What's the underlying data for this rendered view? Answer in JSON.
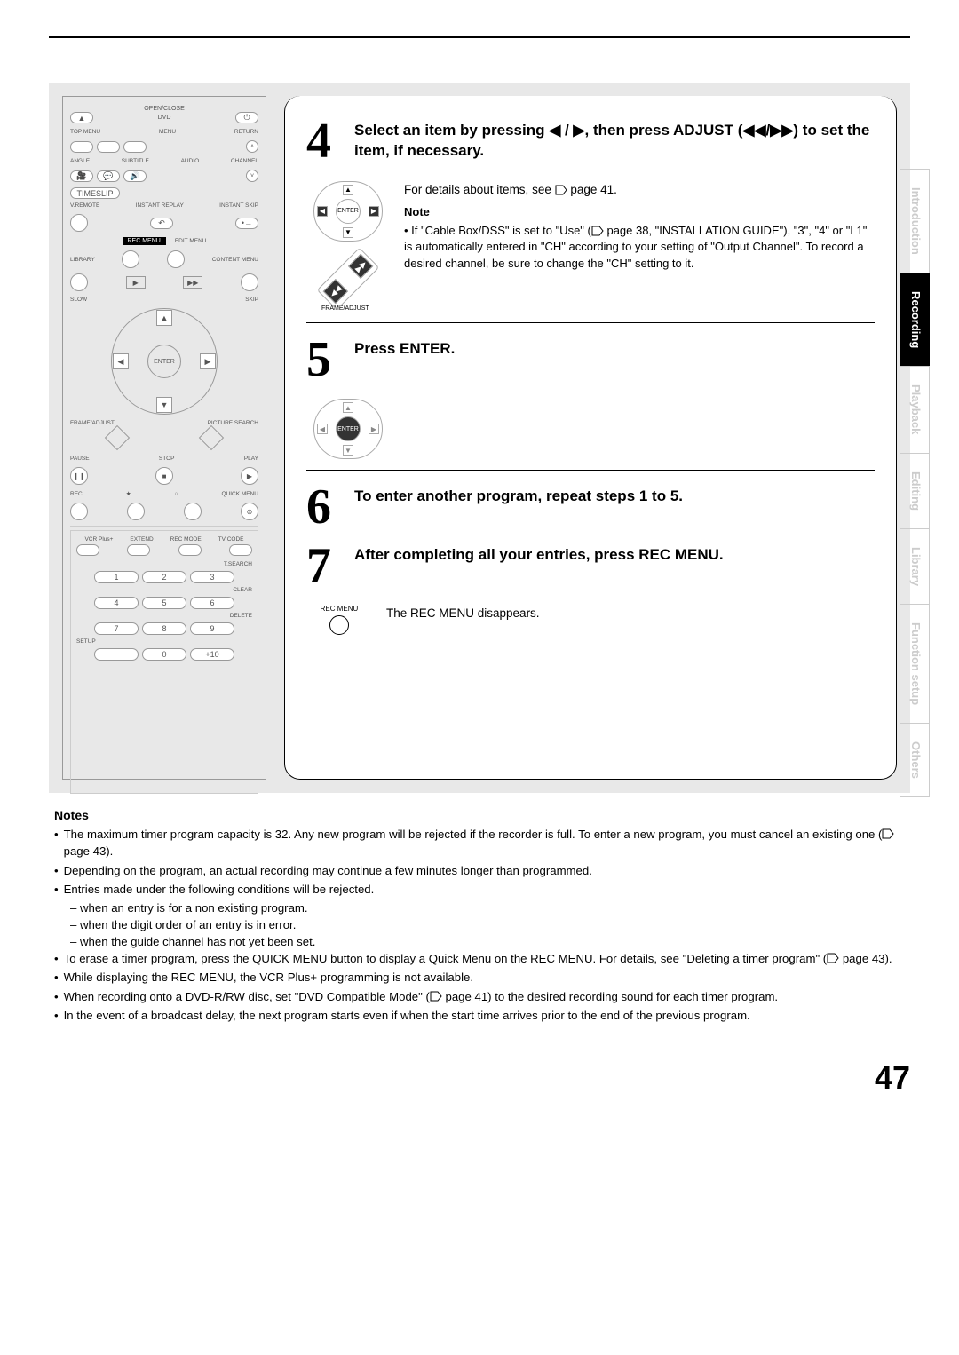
{
  "page_number": "47",
  "side_tabs": [
    "Introduction",
    "Recording",
    "Playback",
    "Editing",
    "Library",
    "Function setup",
    "Others"
  ],
  "active_tab_index": 1,
  "remote": {
    "open_close": "OPEN/CLOSE",
    "dvd": "DVD",
    "top_menu": "TOP MENU",
    "menu": "MENU",
    "return": "RETURN",
    "angle": "ANGLE",
    "subtitle": "SUBTITLE",
    "audio": "AUDIO",
    "channel": "CHANNEL",
    "timeslip": "TIMESLIP",
    "vremote": "V.REMOTE",
    "instant_replay": "INSTANT REPLAY",
    "instant_skip": "INSTANT SKIP",
    "rec_menu": "REC MENU",
    "edit_menu": "EDIT MENU",
    "library": "LIBRARY",
    "content_menu": "CONTENT MENU",
    "enter": "ENTER",
    "skip": "SKIP",
    "slow": "SLOW",
    "frame_adjust": "FRAME/ADJUST",
    "picture_search": "PICTURE SEARCH",
    "pause": "PAUSE",
    "stop": "STOP",
    "play": "PLAY",
    "rec": "REC",
    "quick_menu": "QUICK MENU",
    "vcr_plus": "VCR Plus+",
    "extend": "EXTEND",
    "rec_mode": "REC MODE",
    "tv_code": "TV CODE",
    "t_search": "T.SEARCH",
    "clear": "CLEAR",
    "delete": "DELETE",
    "setup": "SETUP",
    "plus10": "+10"
  },
  "steps": {
    "s4": {
      "num": "4",
      "title": "Select an item by pressing ◀ / ▶, then press ADJUST (◀◀/▶▶) to set the item, if necessary.",
      "body_line1": "For details about items, see ",
      "body_line1_page": "page 41.",
      "note_label": "Note",
      "note_text": "• If \"Cable Box/DSS\" is set to \"Use\" ( page 38, \"INSTALLATION GUIDE\"), \"3\", \"4\" or \"L1\" is automatically entered in \"CH\" according to your setting of \"Output Channel\". To record a desired channel, be sure to change the \"CH\" setting to it.",
      "thumb_enter": "ENTER",
      "thumb_frame": "FRAME/ADJUST"
    },
    "s5": {
      "num": "5",
      "title": "Press ENTER.",
      "thumb_enter": "ENTER"
    },
    "s6": {
      "num": "6",
      "title": "To enter another program, repeat steps 1 to 5."
    },
    "s7": {
      "num": "7",
      "title": "After completing all your entries, press REC MENU.",
      "body": "The REC MENU disappears.",
      "thumb": "REC MENU"
    }
  },
  "notes": {
    "header": "Notes",
    "items": [
      "The maximum timer program capacity is 32. Any new program will be rejected if the recorder is full. To enter a new program, you must cancel an existing one ( page 43).",
      "Depending on the program, an actual recording may continue a few minutes longer than programmed.",
      "Entries made under the following conditions will be rejected.",
      "To erase a timer program, press the QUICK MENU button to display a Quick Menu on the REC MENU. For details, see \"Deleting a timer program\" ( page 43).",
      "While displaying the REC MENU, the VCR Plus+ programming is not available.",
      "When recording onto a DVD-R/RW disc, set \"DVD Compatible Mode\" ( page 41) to the desired recording sound for each timer program.",
      "In the event of a broadcast delay, the next program starts even if when the start time arrives prior to the end of the previous program."
    ],
    "sub_items": [
      "when an entry is for a non existing program.",
      "when the digit order of an entry is in error.",
      "when the guide channel has not yet been set."
    ]
  }
}
